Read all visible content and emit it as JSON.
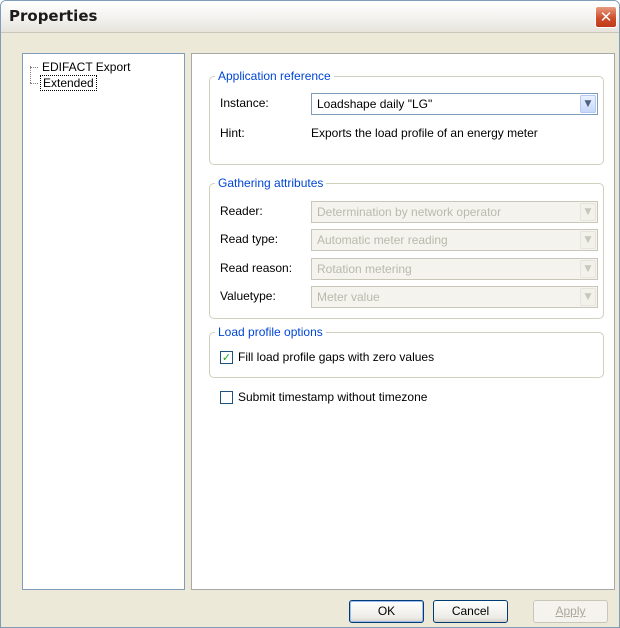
{
  "window": {
    "title": "Properties",
    "close_symbol": "✕"
  },
  "tree": {
    "items": [
      {
        "label": "EDIFACT Export",
        "selected": false
      },
      {
        "label": "Extended",
        "selected": true
      }
    ]
  },
  "application_reference": {
    "legend": "Application reference",
    "instance_label": "Instance:",
    "instance_value": "Loadshape daily \"LG\"",
    "hint_label": "Hint:",
    "hint_value": "Exports the load profile of an energy meter"
  },
  "gathering_attributes": {
    "legend": "Gathering attributes",
    "fields": [
      {
        "label": "Reader:",
        "value": "Determination by network operator"
      },
      {
        "label": "Read type:",
        "value": "Automatic meter reading"
      },
      {
        "label": "Read reason:",
        "value": "Rotation metering"
      },
      {
        "label": "Valuetype:",
        "value": "Meter value"
      }
    ]
  },
  "load_profile_options": {
    "legend": "Load profile options",
    "fill_gaps_label": "Fill load profile gaps with zero values",
    "fill_gaps_checked": true
  },
  "submit_timestamp": {
    "label": "Submit timestamp without timezone",
    "checked": false
  },
  "buttons": {
    "ok": "OK",
    "cancel": "Cancel",
    "apply": "Apply"
  },
  "icons": {
    "dropdown": "chevron-down-icon",
    "check": "checkmark-icon",
    "close": "close-icon"
  },
  "colors": {
    "legend_text": "#0046d5",
    "close_button": "#cf4e2c",
    "checkmark": "#21a121"
  }
}
